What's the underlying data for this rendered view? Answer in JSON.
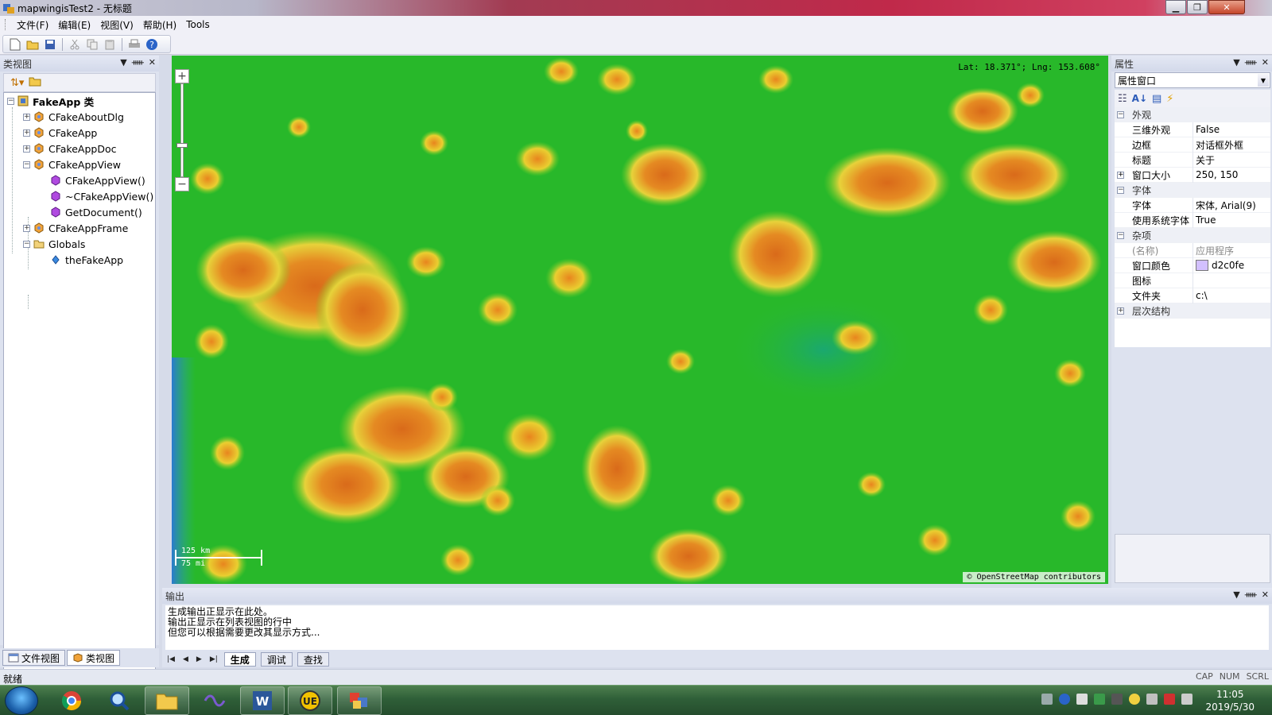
{
  "window": {
    "title": "mapwingisTest2 - 无标题",
    "min_label": "▁",
    "max_label": "❐",
    "close_label": "✕"
  },
  "menu": {
    "items": [
      "文件(F)",
      "编辑(E)",
      "视图(V)",
      "帮助(H)",
      "Tools"
    ]
  },
  "class_view": {
    "title": "类视图",
    "tree": [
      {
        "label": "FakeApp 类",
        "bold": true
      },
      {
        "label": "CFakeAboutDlg"
      },
      {
        "label": "CFakeApp"
      },
      {
        "label": "CFakeAppDoc"
      },
      {
        "label": "CFakeAppView"
      },
      {
        "label": "CFakeAppView()"
      },
      {
        "label": "~CFakeAppView()"
      },
      {
        "label": "GetDocument()"
      },
      {
        "label": "CFakeAppFrame"
      },
      {
        "label": "Globals"
      },
      {
        "label": "theFakeApp"
      }
    ],
    "tabs": [
      "文件视图",
      "类视图"
    ]
  },
  "map": {
    "coords": "Lat: 18.371°; Lng: 153.608°",
    "scale_km": "125 km",
    "scale_mi": "75 mi",
    "attribution": "© OpenStreetMap contributors",
    "zoom_in": "+",
    "zoom_out": "−"
  },
  "properties": {
    "title": "属性",
    "selector": "属性窗口",
    "rows": [
      {
        "type": "cat",
        "name": "外观",
        "exp": "−"
      },
      {
        "name": "三维外观",
        "value": "False"
      },
      {
        "name": "边框",
        "value": "对话框外框"
      },
      {
        "name": "标题",
        "value": "关于"
      },
      {
        "name": "窗口大小",
        "value": "250, 150",
        "exp": "+"
      },
      {
        "type": "cat",
        "name": "字体",
        "exp": "−"
      },
      {
        "name": "字体",
        "value": "宋体, Arial(9)"
      },
      {
        "name": "使用系统字体",
        "value": "True"
      },
      {
        "type": "cat",
        "name": "杂项",
        "exp": "−"
      },
      {
        "name": "(名称)",
        "value": "应用程序",
        "muted": true
      },
      {
        "name": "窗口颜色",
        "value": "d2c0fe",
        "swatch": "#d2c0fe"
      },
      {
        "name": "图标",
        "value": ""
      },
      {
        "name": "文件夹",
        "value": "c:\\"
      },
      {
        "type": "cat",
        "name": "层次结构",
        "exp": "+"
      }
    ]
  },
  "output": {
    "title": "输出",
    "lines": [
      "生成输出正显示在此处。",
      "输出正显示在列表视图的行中",
      "但您可以根据需要更改其显示方式..."
    ],
    "tabs": [
      "生成",
      "调试",
      "查找"
    ]
  },
  "status": {
    "text": "就绪",
    "indicators": [
      "CAP",
      "NUM",
      "SCRL"
    ]
  },
  "taskbar": {
    "apps": [
      "chrome-icon",
      "magnifier-icon",
      "explorer-icon",
      "vs-icon",
      "word-icon",
      "ultraedit-icon",
      "mfc-icon"
    ],
    "time": "11:05",
    "date": "2019/5/30"
  }
}
